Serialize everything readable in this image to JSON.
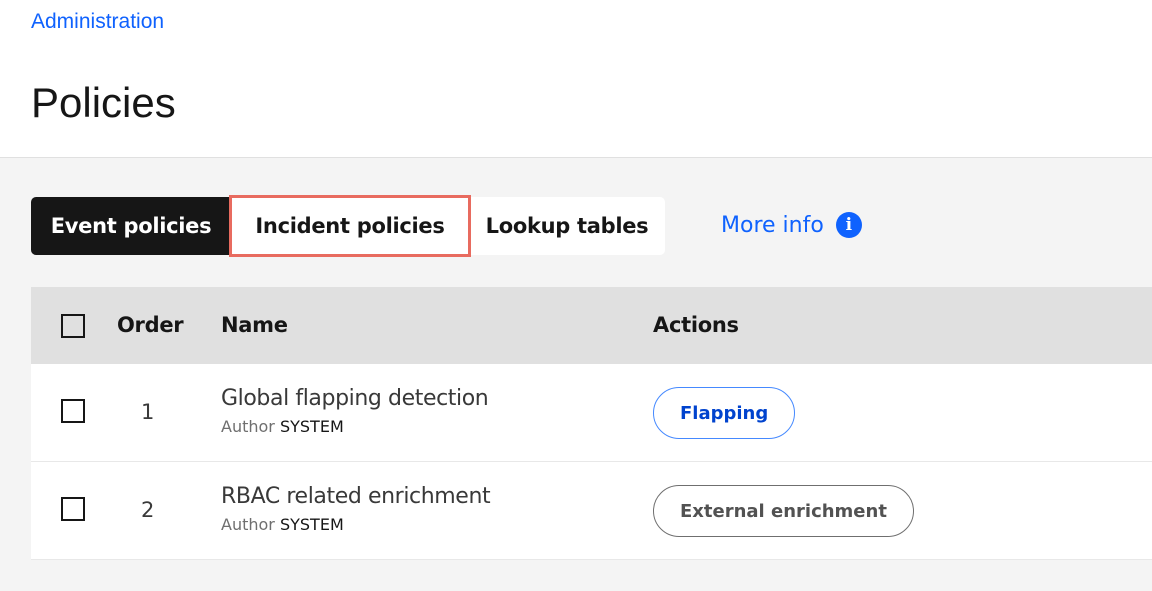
{
  "breadcrumb": {
    "label": "Administration"
  },
  "page": {
    "title": "Policies"
  },
  "tabs": [
    {
      "label": "Event policies",
      "selected": true
    },
    {
      "label": "Incident policies",
      "selected": false,
      "highlighted": true
    },
    {
      "label": "Lookup tables",
      "selected": false
    }
  ],
  "more_info": {
    "label": "More info",
    "icon": "info-icon"
  },
  "table": {
    "columns": {
      "order": "Order",
      "name": "Name",
      "actions": "Actions"
    },
    "rows": [
      {
        "order": "1",
        "name": "Global flapping detection",
        "author_label": "Author",
        "author": "SYSTEM",
        "action": "Flapping"
      },
      {
        "order": "2",
        "name": "RBAC related enrichment",
        "author_label": "Author",
        "author": "SYSTEM",
        "action": "External enrichment"
      }
    ]
  },
  "colors": {
    "accent": "#0f62fe",
    "selected_tab": "#161616",
    "highlight_outline": "#e86b5f"
  }
}
